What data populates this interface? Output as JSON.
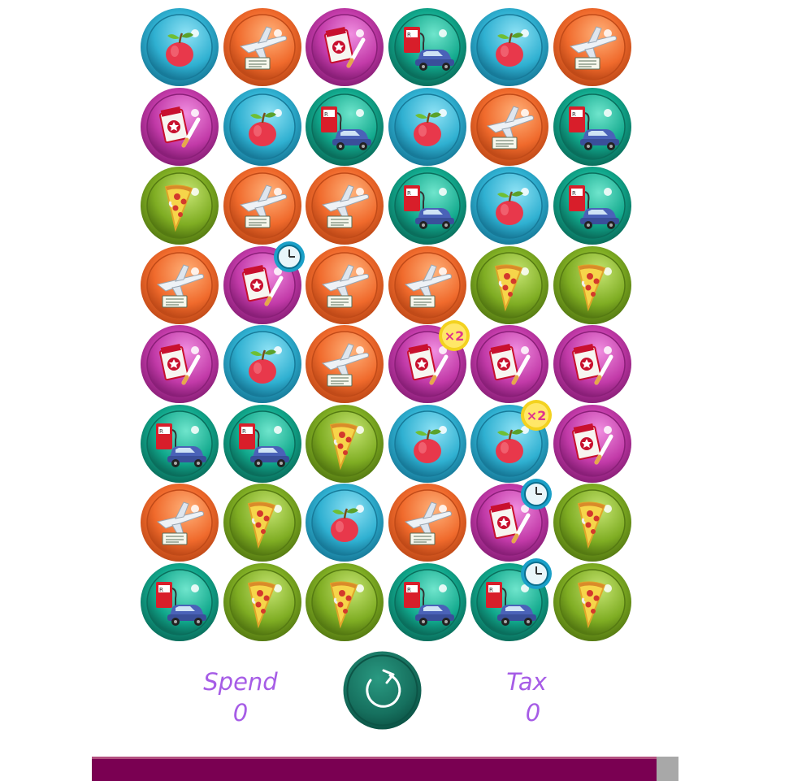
{
  "board": {
    "rows": [
      [
        "groceries",
        "travel",
        "smoking",
        "fuel",
        "groceries",
        "travel"
      ],
      [
        "smoking",
        "groceries",
        "fuel",
        "groceries",
        "travel",
        "fuel"
      ],
      [
        "pizza",
        "travel",
        "travel",
        "fuel",
        "groceries",
        "fuel"
      ],
      [
        "travel",
        "smoking",
        "travel",
        "travel",
        "pizza",
        "pizza"
      ],
      [
        "smoking",
        "groceries",
        "travel",
        "smoking",
        "smoking",
        "smoking"
      ],
      [
        "fuel",
        "fuel",
        "pizza",
        "groceries",
        "groceries",
        "smoking"
      ],
      [
        "travel",
        "pizza",
        "groceries",
        "travel",
        "smoking",
        "pizza"
      ],
      [
        "fuel",
        "pizza",
        "pizza",
        "fuel",
        "fuel",
        "pizza"
      ]
    ],
    "badges": [
      {
        "row": 3,
        "col": 1,
        "type": "clock"
      },
      {
        "row": 4,
        "col": 3,
        "type": "x2",
        "text": "×2"
      },
      {
        "row": 5,
        "col": 4,
        "type": "x2",
        "text": "×2"
      },
      {
        "row": 6,
        "col": 4,
        "type": "clock"
      },
      {
        "row": 7,
        "col": 4,
        "type": "clock"
      }
    ],
    "categories": {
      "groceries": {
        "icon": "apple-icon",
        "color": "#2fb0d1",
        "dark": "#177a99",
        "light": "#8fe2f5"
      },
      "travel": {
        "icon": "airplane-icon",
        "color": "#f06a2c",
        "dark": "#c04a18",
        "light": "#ffb27a"
      },
      "smoking": {
        "icon": "cigarettes-icon",
        "color": "#c23aa8",
        "dark": "#8a1f78",
        "light": "#f08ee0"
      },
      "fuel": {
        "icon": "fuel-car-icon",
        "color": "#11a88c",
        "dark": "#0a6e5c",
        "light": "#6fe5cc"
      },
      "pizza": {
        "icon": "pizza-icon",
        "color": "#7fad23",
        "dark": "#557a12",
        "light": "#c6e572"
      }
    }
  },
  "scores": {
    "spend_label": "Spend",
    "spend_value": "0",
    "tax_label": "Tax",
    "tax_value": "0"
  },
  "refresh": {
    "icon": "refresh-icon",
    "color": "#1a7a66"
  },
  "progress": {
    "fraction": 0.962,
    "fill_color": "#7a0052",
    "track_color": "#a8a8a8"
  }
}
